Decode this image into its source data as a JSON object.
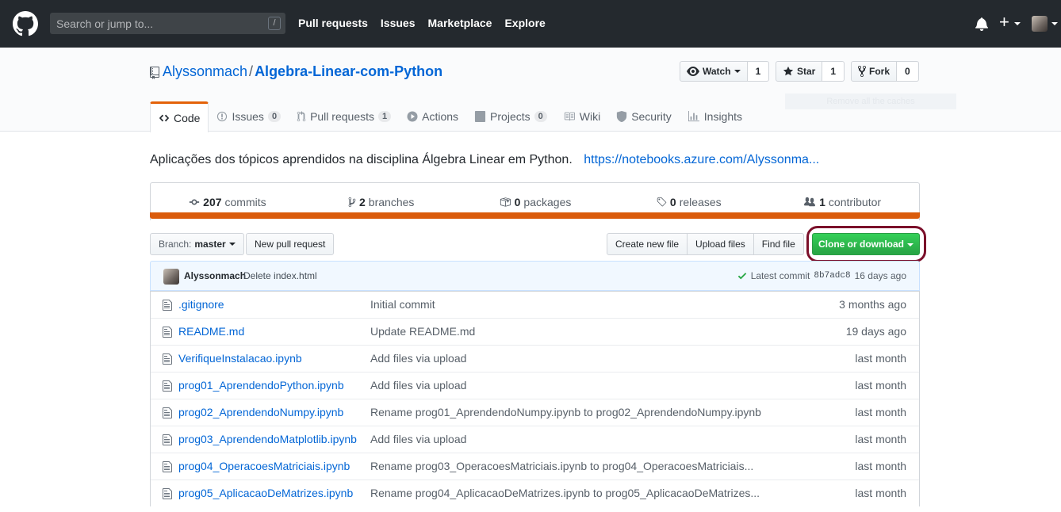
{
  "header": {
    "search_placeholder": "Search or jump to...",
    "search_key": "/",
    "nav": [
      "Pull requests",
      "Issues",
      "Marketplace",
      "Explore"
    ],
    "plus": "+"
  },
  "repo": {
    "owner": "Alyssonmach",
    "separator": "/",
    "name": "Algebra-Linear-com-Python",
    "ghost_button": "Remove all the caches",
    "watch": {
      "label": "Watch",
      "count": "1"
    },
    "star": {
      "label": "Star",
      "count": "1"
    },
    "fork": {
      "label": "Fork",
      "count": "0"
    }
  },
  "tabs": [
    {
      "label": "Code",
      "icon": "code-icon"
    },
    {
      "label": "Issues",
      "count": "0",
      "icon": "issue-icon"
    },
    {
      "label": "Pull requests",
      "count": "1",
      "icon": "pull-request-icon"
    },
    {
      "label": "Actions",
      "icon": "play-icon"
    },
    {
      "label": "Projects",
      "count": "0",
      "icon": "project-icon"
    },
    {
      "label": "Wiki",
      "icon": "book-icon"
    },
    {
      "label": "Security",
      "icon": "shield-icon"
    },
    {
      "label": "Insights",
      "icon": "graph-icon"
    }
  ],
  "description": {
    "text": "Aplicações dos tópicos aprendidos na disciplina Álgebra Linear em Python.",
    "url": "https://notebooks.azure.com/Alyssonma..."
  },
  "summary": {
    "commits": {
      "count": "207",
      "label": "commits"
    },
    "branches": {
      "count": "2",
      "label": "branches"
    },
    "packages": {
      "count": "0",
      "label": "packages"
    },
    "releases": {
      "count": "0",
      "label": "releases"
    },
    "contributors": {
      "count": "1",
      "label": "contributor"
    }
  },
  "filenav": {
    "branch_label": "Branch:",
    "branch_value": "master",
    "new_pr": "New pull request",
    "create_file": "Create new file",
    "upload_files": "Upload files",
    "find_file": "Find file",
    "clone": "Clone or download"
  },
  "latest_commit": {
    "author": "Alyssonmach",
    "message": "Delete index.html",
    "label": "Latest commit",
    "sha": "8b7adc8",
    "age": "16 days ago"
  },
  "files": [
    {
      "name": ".gitignore",
      "message": "Initial commit",
      "age": "3 months ago"
    },
    {
      "name": "README.md",
      "message": "Update README.md",
      "age": "19 days ago"
    },
    {
      "name": "VerifiqueInstalacao.ipynb",
      "message": "Add files via upload",
      "age": "last month"
    },
    {
      "name": "prog01_AprendendoPython.ipynb",
      "message": "Add files via upload",
      "age": "last month"
    },
    {
      "name": "prog02_AprendendoNumpy.ipynb",
      "message": "Rename prog01_AprendendoNumpy.ipynb to prog02_AprendendoNumpy.ipynb",
      "age": "last month"
    },
    {
      "name": "prog03_AprendendoMatplotlib.ipynb",
      "message": "Add files via upload",
      "age": "last month"
    },
    {
      "name": "prog04_OperacoesMatriciais.ipynb",
      "message": "Rename prog03_OperacoesMatriciais.ipynb to prog04_OperacoesMatriciais...",
      "age": "last month"
    },
    {
      "name": "prog05_AplicacaoDeMatrizes.ipynb",
      "message": "Rename prog04_AplicacaoDeMatrizes.ipynb to prog05_AplicacaoDeMatrizes...",
      "age": "last month"
    }
  ],
  "colors": {
    "header_bg": "#24292e",
    "link": "#0366d6",
    "active_tab_accent": "#e36209",
    "language_bar": "#da5b0b",
    "clone_button": "#28a745",
    "highlight_ring": "#7b0f2a"
  }
}
